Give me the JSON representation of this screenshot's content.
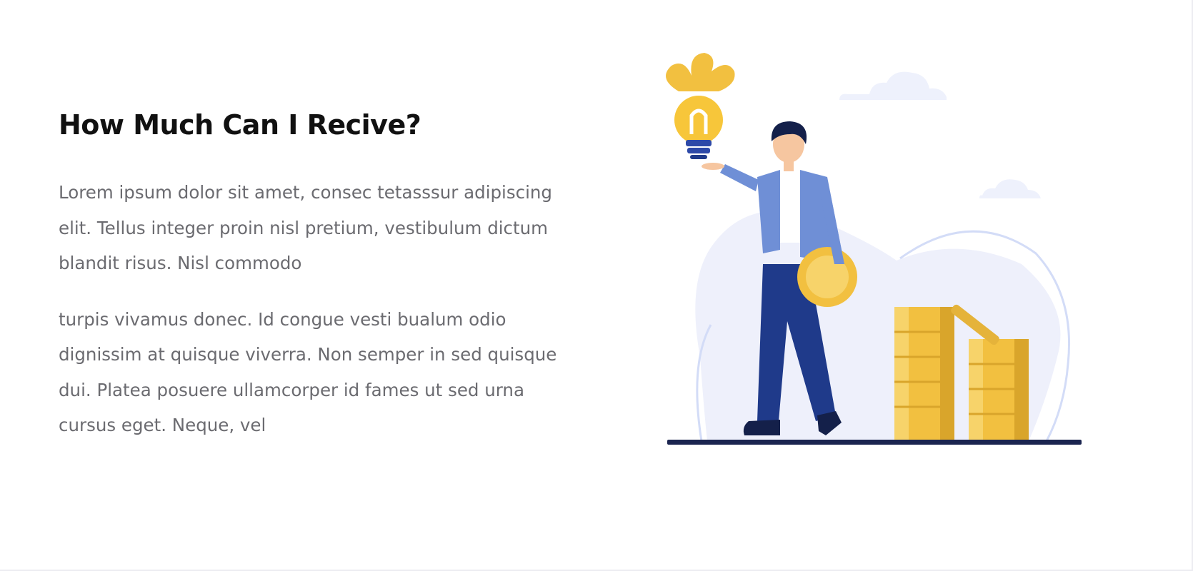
{
  "section": {
    "title": "How Much Can I Recive?",
    "paragraphs": [
      "Lorem ipsum dolor sit amet, consec tetasssur adipiscing elit. Tellus integer proin nisl pretium, vestibulum dictum blandit risus. Nisl commodo",
      "turpis vivamus donec. Id congue vesti bualum odio dignissim at quisque viverra. Non semper in sed quisque dui. Platea posuere ullamcorper id fames ut sed urna cursus eget. Neque, vel"
    ]
  },
  "illustration": {
    "icon": "man-with-lightbulb-and-coins-illustration",
    "colors": {
      "blob": "#eef0fb",
      "ring": "#d3dcf7",
      "cloud": "#eef1fc",
      "jacket": "#6f8fd6",
      "pants": "#1f3a8a",
      "hair": "#14204a",
      "gold": "#f2c040",
      "gold_dark": "#d9a52b",
      "ground": "#1b2550"
    }
  }
}
